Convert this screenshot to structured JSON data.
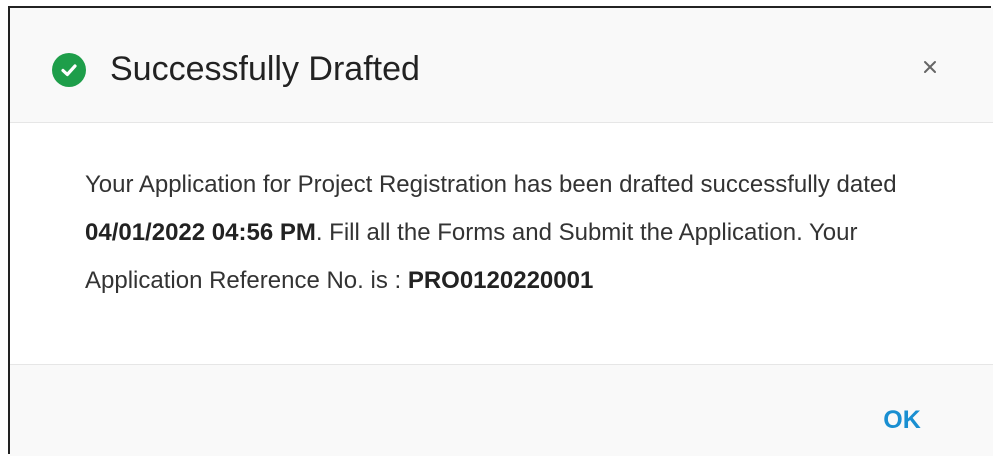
{
  "dialog": {
    "title": "Successfully Drafted",
    "status_icon": "check-circle-icon",
    "close_icon": "close-icon",
    "close_label": "×",
    "message": {
      "part1": "Your Application for Project Registration has been drafted successfully dated ",
      "date": "04/01/2022 04:56 PM",
      "part2": ". Fill all the Forms and Submit the Application. Your Application Reference No. is : ",
      "reference_no": "PRO0120220001"
    },
    "ok_label": "OK"
  },
  "colors": {
    "success": "#1e9e4a",
    "link": "#1a8fd1",
    "header_bg": "#f9f9f9"
  }
}
